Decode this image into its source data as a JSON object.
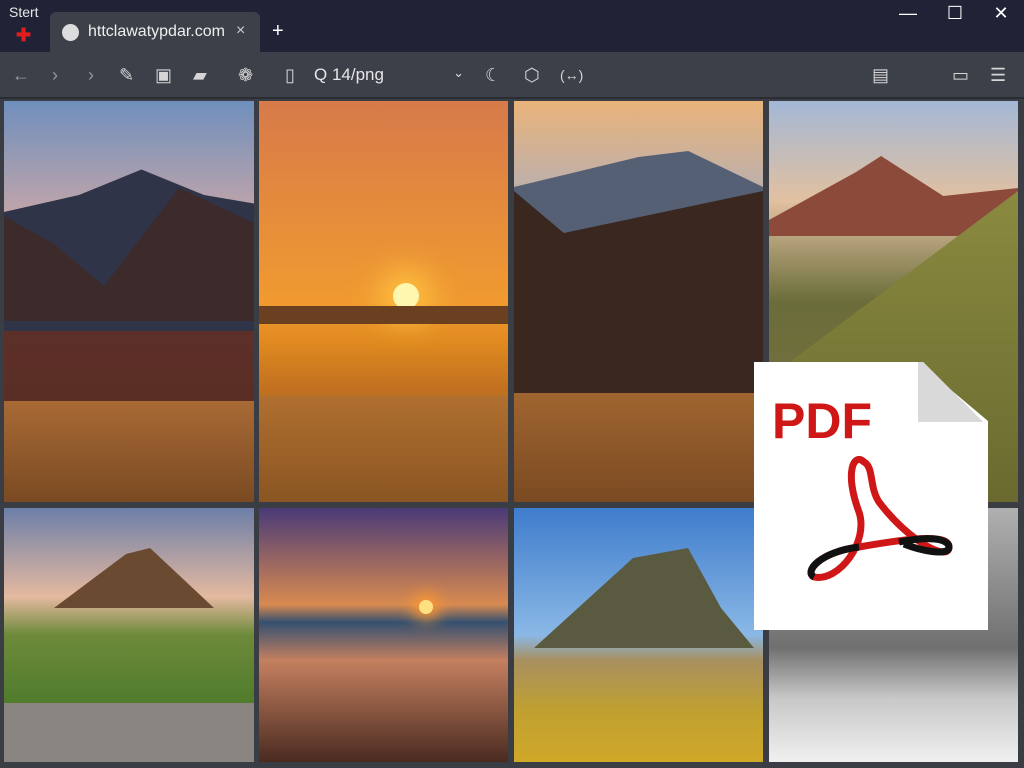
{
  "titlebar": {
    "start_label": "Stert",
    "tab_title": "httclawatypdar.com",
    "tab_close": "×",
    "new_tab": "+",
    "minimize": "—",
    "maximize": "☐",
    "close": "✕"
  },
  "toolbar": {
    "url_text": "Q 14/png",
    "caret": "⌄",
    "icons": [
      "back-icon",
      "forward-icon",
      "forward2-icon",
      "pen-icon",
      "image-icon",
      "book-icon",
      "share-icon",
      "document-icon",
      "moon-icon",
      "download-icon",
      "code-icon",
      "clipboard-icon",
      "screen-icon",
      "menu-icon"
    ]
  },
  "pdf_icon": {
    "label": "PDF",
    "color": "#d01717"
  },
  "gallery": {
    "count": 8
  }
}
